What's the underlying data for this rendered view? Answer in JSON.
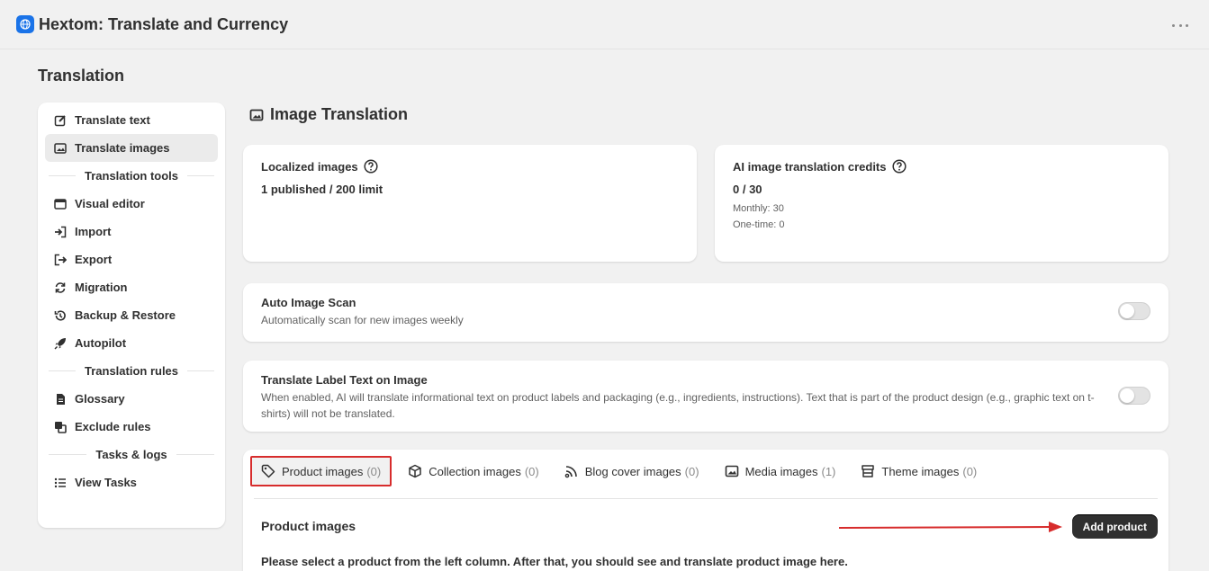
{
  "app": {
    "title": "Hextom: Translate and Currency",
    "logo_icon": "globe-icon",
    "accent": "#1a73e8"
  },
  "page": {
    "title": "Translation"
  },
  "sidebar": {
    "items": [
      {
        "label": "Translate text",
        "icon": "edit-icon"
      },
      {
        "label": "Translate images",
        "icon": "image-icon",
        "active": true
      }
    ],
    "tools_heading": "Translation tools",
    "tools": [
      {
        "label": "Visual editor",
        "icon": "window-icon"
      },
      {
        "label": "Import",
        "icon": "import-icon"
      },
      {
        "label": "Export",
        "icon": "export-icon"
      },
      {
        "label": "Migration",
        "icon": "refresh-icon"
      },
      {
        "label": "Backup & Restore",
        "icon": "history-icon"
      },
      {
        "label": "Autopilot",
        "icon": "rocket-icon"
      }
    ],
    "rules_heading": "Translation rules",
    "rules": [
      {
        "label": "Glossary",
        "icon": "document-icon"
      },
      {
        "label": "Exclude rules",
        "icon": "exclude-icon"
      }
    ],
    "tasks_heading": "Tasks & logs",
    "tasks": [
      {
        "label": "View Tasks",
        "icon": "list-icon"
      }
    ]
  },
  "section": {
    "title": "Image Translation",
    "icon": "image-icon"
  },
  "stats": {
    "localized": {
      "label": "Localized images",
      "value": "1 published / 200 limit"
    },
    "credits": {
      "label": "AI image translation credits",
      "value": "0 / 30",
      "monthly": "Monthly: 30",
      "onetime": "One-time: 0"
    }
  },
  "auto_scan": {
    "title": "Auto Image Scan",
    "description": "Automatically scan for new images weekly",
    "enabled": false
  },
  "label_text": {
    "title": "Translate Label Text on Image",
    "description": "When enabled, AI will translate informational text on product labels and packaging (e.g., ingredients, instructions). Text that is part of the product design (e.g., graphic text on t-shirts) will not be translated.",
    "enabled": false
  },
  "tabs": [
    {
      "label": "Product images",
      "count": "(0)",
      "icon": "tag-icon",
      "active": true
    },
    {
      "label": "Collection images",
      "count": "(0)",
      "icon": "cube-icon"
    },
    {
      "label": "Blog cover images",
      "count": "(0)",
      "icon": "rss-icon"
    },
    {
      "label": "Media images",
      "count": "(1)",
      "icon": "image-icon"
    },
    {
      "label": "Theme images",
      "count": "(0)",
      "icon": "store-icon"
    }
  ],
  "product_images": {
    "title": "Product images",
    "add_button": "Add product",
    "info": "Please select a product from the left column. After that, you should see and translate product image here."
  },
  "annotation_color": "#d72c2c"
}
